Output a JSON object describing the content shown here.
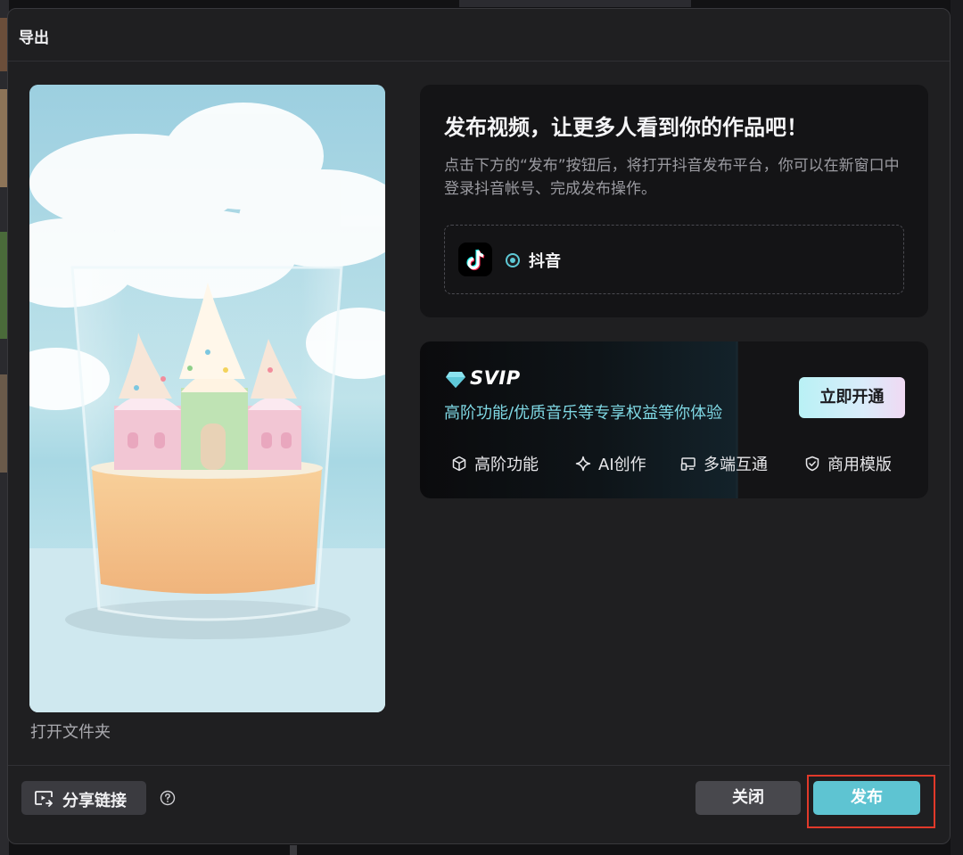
{
  "dialog": {
    "title": "导出"
  },
  "preview": {
    "open_folder_label": "打开文件夹"
  },
  "publish": {
    "heading": "发布视频，让更多人看到你的作品吧！",
    "description": "点击下方的“发布”按钮后，将打开抖音发布平台，你可以在新窗口中登录抖音帐号、完成发布操作。",
    "platform": {
      "name": "抖音",
      "selected": true,
      "icon": "tiktok-logo"
    }
  },
  "svip": {
    "badge": "SVIP",
    "subtitle": "高阶功能/优质音乐等专享权益等你体验",
    "button_label": "立即开通",
    "features": [
      {
        "label": "高阶功能",
        "icon": "cube-icon"
      },
      {
        "label": "AI创作",
        "icon": "sparkle-icon"
      },
      {
        "label": "多端互通",
        "icon": "devices-icon"
      },
      {
        "label": "商用模版",
        "icon": "shield-check-icon"
      }
    ]
  },
  "footer": {
    "share_label": "分享链接",
    "close_label": "关闭",
    "publish_label": "发布"
  },
  "colors": {
    "accent": "#5ec4d2",
    "highlight": "#e1392a",
    "dialog_bg": "#1f1f21",
    "card_bg": "#141416"
  }
}
